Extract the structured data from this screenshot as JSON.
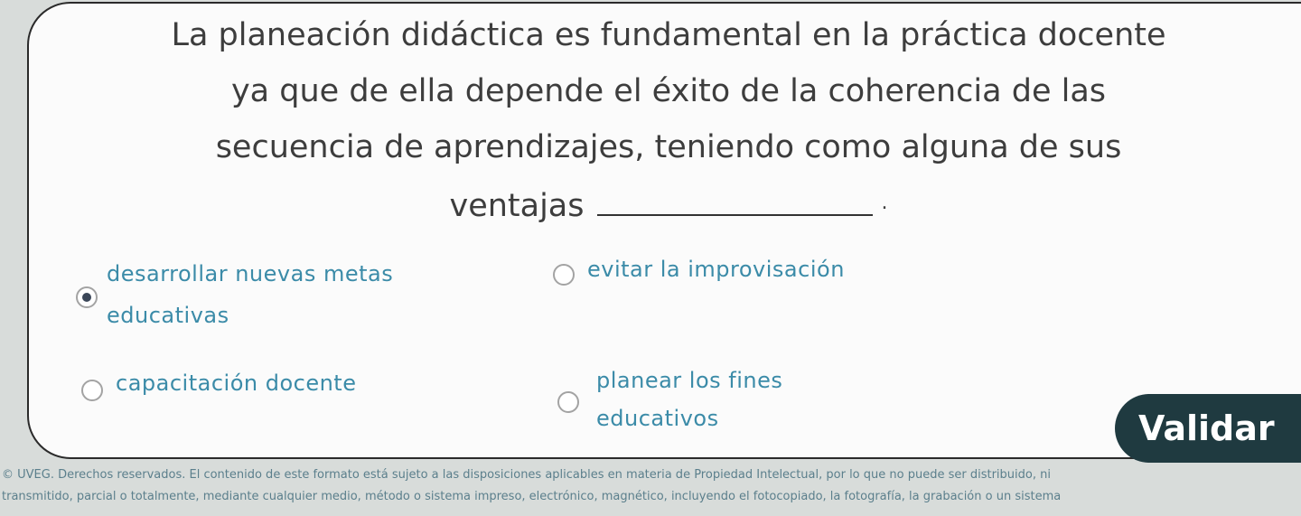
{
  "question": {
    "line1": "La planeación didáctica es fundamental en la práctica docente",
    "line2": "ya que de ella depende el éxito de la coherencia de las",
    "line3": "secuencia de aprendizajes, teniendo como alguna de sus",
    "line4": "ventajas",
    "end_mark": "."
  },
  "options": {
    "a": {
      "line1": "desarrollar nuevas metas",
      "line2": "educativas",
      "selected": true
    },
    "b": {
      "line1": "evitar la improvisación",
      "selected": false
    },
    "c": {
      "line1": "capacitación docente",
      "selected": false
    },
    "d": {
      "line1": "planear los fines",
      "line2": "educativos",
      "selected": false
    }
  },
  "validate_label": "Validar",
  "footer": {
    "line1": "© UVEG. Derechos reservados. El contenido de este formato está sujeto a las disposiciones aplicables en materia de Propiedad Intelectual, por lo que no puede ser distribuido, ni",
    "line2": "transmitido, parcial o totalmente, mediante cualquier medio, método o sistema impreso, electrónico, magnético, incluyendo el fotocopiado, la fotografía, la grabación o un sistema"
  },
  "colors": {
    "option_text": "#3b8ba8",
    "button_bg": "#1f3a40",
    "question_text": "#3d3d3d"
  }
}
